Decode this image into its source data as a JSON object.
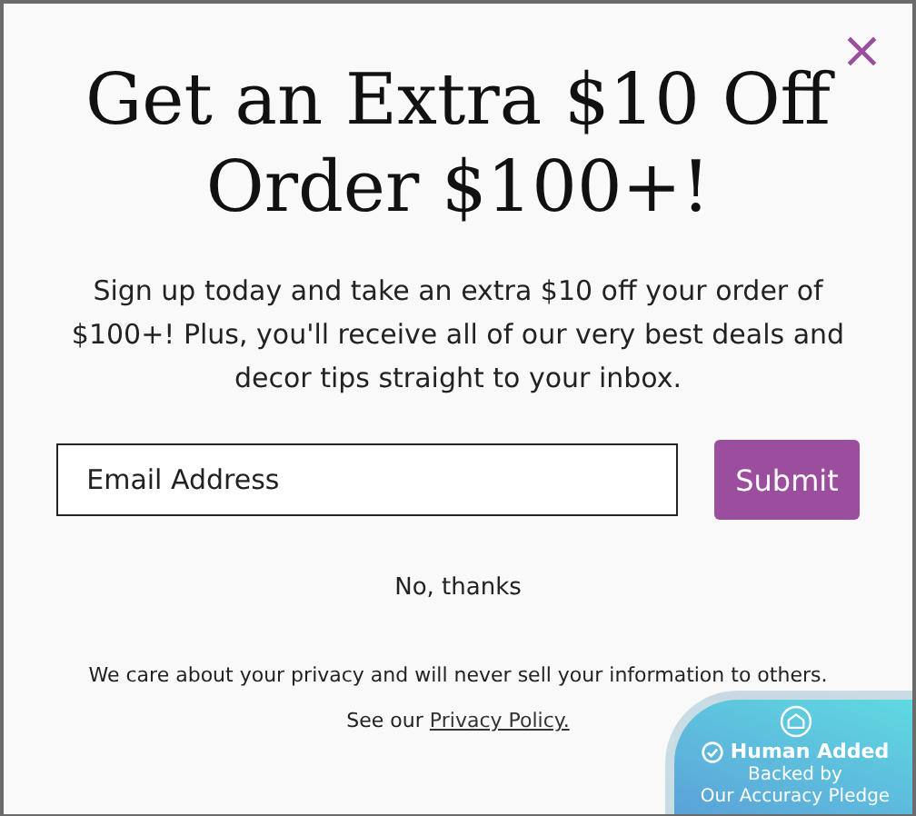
{
  "close": {
    "symbol": "×"
  },
  "headline": [
    "Get an Extra $10 Off",
    "Order $100+!"
  ],
  "description": "Sign up today and take an extra $10 off your order of $100+! Plus, you'll receive all of our very best deals and decor tips straight to your inbox.",
  "email": {
    "placeholder": "Email Address"
  },
  "submit": "Submit",
  "decline": "No, thanks",
  "privacy_note": "We care about your privacy and will never sell your information to others.",
  "policy": {
    "lead": "See our",
    "link": "Privacy Policy."
  },
  "badge": {
    "title": "Human Added",
    "subtitle": [
      "Backed by",
      "Our Accuracy Pledge"
    ]
  }
}
